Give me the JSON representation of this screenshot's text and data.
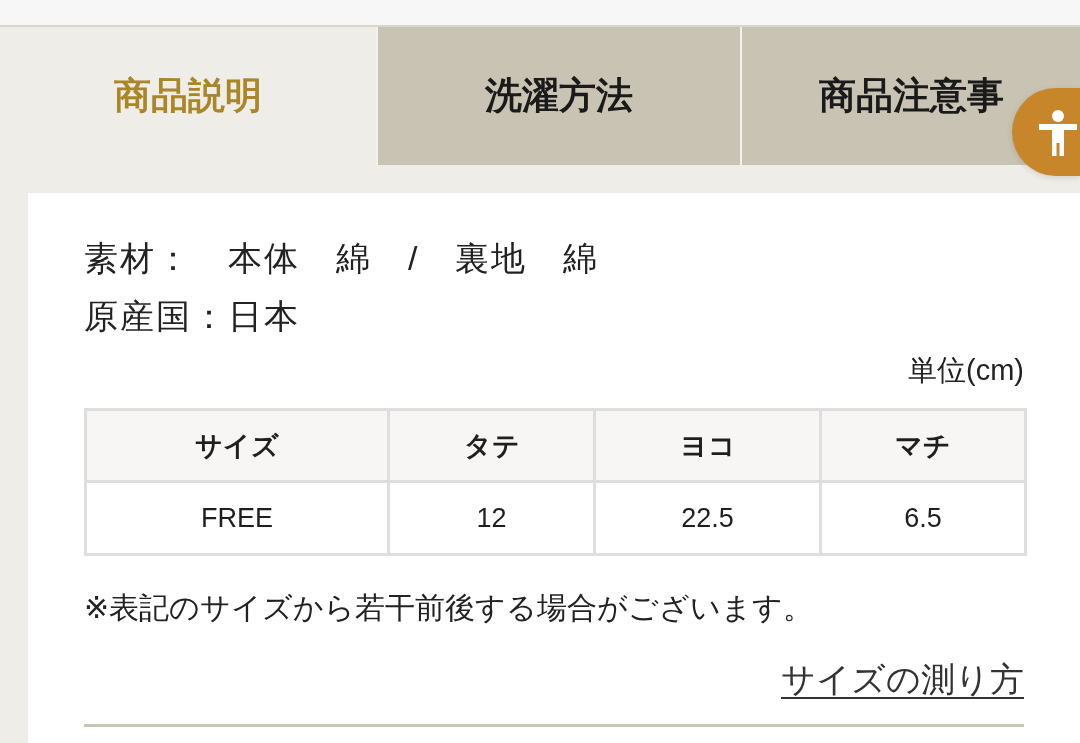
{
  "tabs": [
    {
      "label": "商品説明",
      "selected": true
    },
    {
      "label": "洗濯方法",
      "selected": false
    },
    {
      "label": "商品注意事",
      "selected": false
    }
  ],
  "details": [
    "素材：　本体　綿　/　裏地　綿",
    "原産国：日本"
  ],
  "unit_label": "単位(cm)",
  "size_table": {
    "columns": [
      "サイズ",
      "タテ",
      "ヨコ",
      "マチ"
    ],
    "rows": [
      [
        "FREE",
        "12",
        "22.5",
        "6.5"
      ]
    ]
  },
  "note": "※表記のサイズから若干前後する場合がございます。",
  "measure_link": "サイズの測り方"
}
